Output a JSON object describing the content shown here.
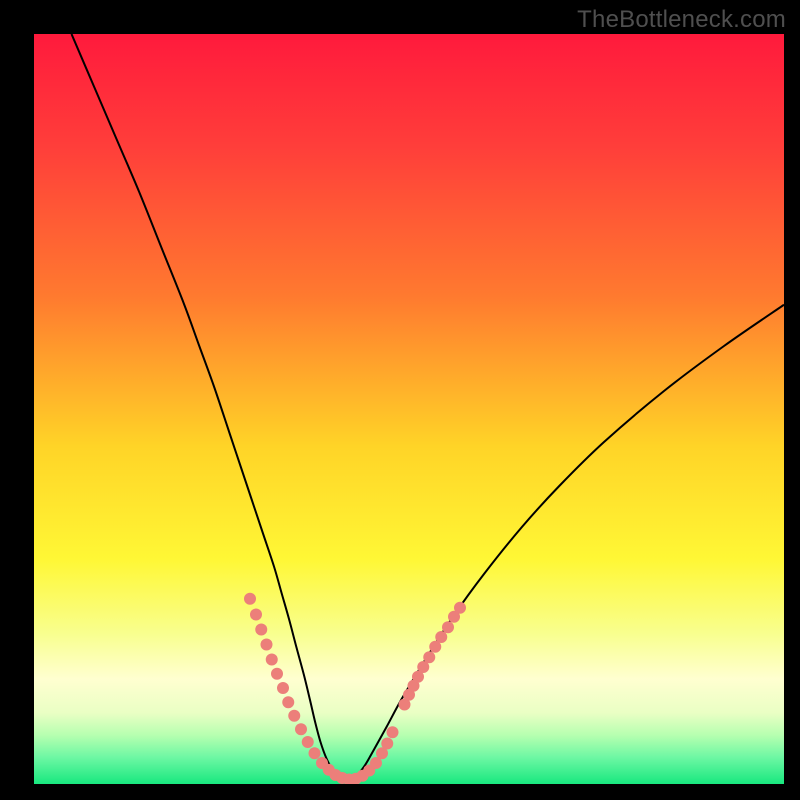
{
  "watermark": "TheBottleneck.com",
  "chart_data": {
    "type": "line",
    "title": "",
    "xlabel": "",
    "ylabel": "",
    "xlim": [
      0,
      100
    ],
    "ylim": [
      0,
      100
    ],
    "background_gradient": {
      "stops": [
        {
          "offset": 0.0,
          "color": "#ff1a3c"
        },
        {
          "offset": 0.15,
          "color": "#ff3e3a"
        },
        {
          "offset": 0.35,
          "color": "#ff7a2f"
        },
        {
          "offset": 0.55,
          "color": "#ffd427"
        },
        {
          "offset": 0.7,
          "color": "#fff735"
        },
        {
          "offset": 0.8,
          "color": "#f8ff8f"
        },
        {
          "offset": 0.86,
          "color": "#ffffd0"
        },
        {
          "offset": 0.905,
          "color": "#eaffc4"
        },
        {
          "offset": 0.935,
          "color": "#b6ffb0"
        },
        {
          "offset": 0.965,
          "color": "#6cf7a3"
        },
        {
          "offset": 1.0,
          "color": "#18e87f"
        }
      ]
    },
    "series": [
      {
        "name": "bottleneck-curve",
        "color": "#000000",
        "x": [
          5,
          8,
          11,
          14,
          17,
          20,
          22,
          24,
          26,
          27.5,
          29,
          30.5,
          32,
          33,
          34,
          35,
          36,
          36.8,
          37.5,
          38.2,
          39,
          40,
          41,
          42,
          43,
          44,
          45,
          47,
          49,
          52,
          56,
          60,
          65,
          70,
          76,
          84,
          92,
          100
        ],
        "y": [
          100,
          93,
          86,
          79,
          71.5,
          64,
          58.5,
          53,
          47,
          42.5,
          38,
          33.5,
          29,
          25.5,
          22,
          18.2,
          14.5,
          11.2,
          8.2,
          5.6,
          3.4,
          1.6,
          0.7,
          0.6,
          1.1,
          2.3,
          4.0,
          7.6,
          11.3,
          16.3,
          22.5,
          28.0,
          34.2,
          39.7,
          45.6,
          52.4,
          58.4,
          63.9
        ]
      }
    ],
    "overlay_points": {
      "color": "#ec7f7a",
      "radius": 6,
      "points": [
        [
          28.8,
          24.7
        ],
        [
          29.6,
          22.6
        ],
        [
          30.3,
          20.6
        ],
        [
          31.0,
          18.6
        ],
        [
          31.7,
          16.6
        ],
        [
          32.4,
          14.7
        ],
        [
          33.2,
          12.8
        ],
        [
          33.9,
          10.9
        ],
        [
          34.7,
          9.1
        ],
        [
          35.6,
          7.3
        ],
        [
          36.5,
          5.6
        ],
        [
          37.4,
          4.1
        ],
        [
          38.4,
          2.8
        ],
        [
          39.3,
          1.9
        ],
        [
          40.2,
          1.2
        ],
        [
          41.1,
          0.8
        ],
        [
          42.0,
          0.6
        ],
        [
          42.9,
          0.7
        ],
        [
          43.8,
          1.1
        ],
        [
          44.7,
          1.8
        ],
        [
          45.6,
          2.8
        ],
        [
          46.4,
          4.1
        ],
        [
          47.1,
          5.4
        ],
        [
          47.8,
          6.9
        ],
        [
          49.4,
          10.6
        ],
        [
          50.0,
          11.9
        ],
        [
          50.6,
          13.1
        ],
        [
          51.2,
          14.3
        ],
        [
          51.9,
          15.6
        ],
        [
          52.7,
          16.9
        ],
        [
          53.5,
          18.3
        ],
        [
          54.3,
          19.6
        ],
        [
          55.2,
          20.9
        ],
        [
          56.0,
          22.3
        ],
        [
          56.8,
          23.5
        ]
      ]
    }
  }
}
